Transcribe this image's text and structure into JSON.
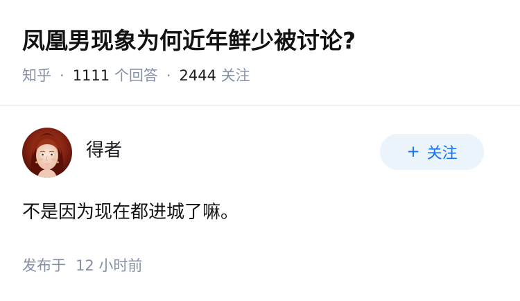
{
  "question": {
    "title": "凤凰男现象为何近年鲜少被讨论?",
    "source": "知乎",
    "separator": "·",
    "answer_count": "1111",
    "answer_label": "个回答",
    "follower_count": "2444",
    "follower_label": "关注"
  },
  "answer": {
    "author_name": "得者",
    "follow_plus": "+",
    "follow_label": "关注",
    "content": "不是因为现在都进城了嘛。",
    "time_label": "发布于",
    "time_value": "12 小时前"
  },
  "colors": {
    "title": "#121212",
    "meta": "#8590a6",
    "accent": "#1772f6",
    "follow_bg": "#ebf3fb"
  }
}
